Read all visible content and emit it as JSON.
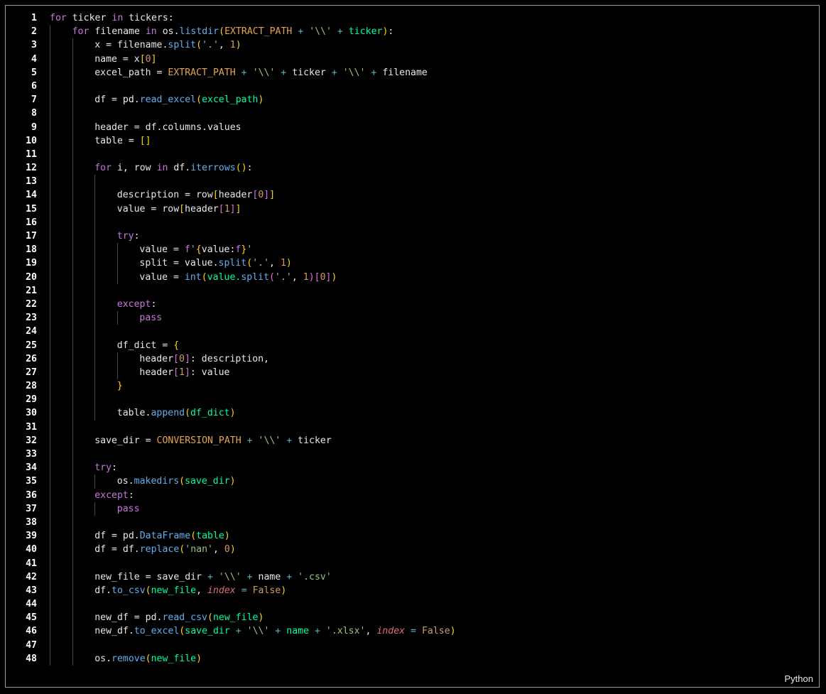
{
  "editor": {
    "language": "Python",
    "lines": [
      {
        "n": "1",
        "indent": 0,
        "tokens": [
          [
            "kw",
            "for"
          ],
          [
            "",
            "ticker"
          ],
          [
            "kw",
            "in"
          ],
          [
            "",
            "tickers:"
          ]
        ]
      },
      {
        "n": "2",
        "indent": 1,
        "tokens": [
          [
            "kw",
            "for"
          ],
          [
            "",
            "filename"
          ],
          [
            "kw",
            "in"
          ],
          [
            "",
            "os."
          ],
          [
            "fn",
            "listdir"
          ],
          [
            "b1",
            "("
          ],
          [
            "const",
            "EXTRACT_PATH"
          ],
          [
            "op",
            "+"
          ],
          [
            "str",
            "'\\\\'"
          ],
          [
            "op",
            "+"
          ],
          [
            "arg",
            "ticker"
          ],
          [
            "b1",
            ")"
          ],
          [
            "",
            ":"
          ]
        ]
      },
      {
        "n": "3",
        "indent": 2,
        "tokens": [
          [
            "",
            "x = filename."
          ],
          [
            "fn",
            "split"
          ],
          [
            "b1",
            "("
          ],
          [
            "str",
            "'.'"
          ],
          [
            "",
            ","
          ],
          [
            "num",
            "1"
          ],
          [
            "b1",
            ")"
          ]
        ]
      },
      {
        "n": "4",
        "indent": 2,
        "tokens": [
          [
            "",
            "name = x"
          ],
          [
            "b1",
            "["
          ],
          [
            "num",
            "0"
          ],
          [
            "b1",
            "]"
          ]
        ]
      },
      {
        "n": "5",
        "indent": 2,
        "tokens": [
          [
            "",
            "excel_path ="
          ],
          [
            "const",
            "EXTRACT_PATH"
          ],
          [
            "op",
            "+"
          ],
          [
            "str",
            "'\\\\'"
          ],
          [
            "op",
            "+"
          ],
          [
            "",
            "ticker"
          ],
          [
            "op",
            "+"
          ],
          [
            "str",
            "'\\\\'"
          ],
          [
            "op",
            "+"
          ],
          [
            "",
            "filename"
          ]
        ]
      },
      {
        "n": "6",
        "indent": 2,
        "tokens": []
      },
      {
        "n": "7",
        "indent": 2,
        "tokens": [
          [
            "",
            "df = pd."
          ],
          [
            "fn",
            "read_excel"
          ],
          [
            "b1",
            "("
          ],
          [
            "arg",
            "excel_path"
          ],
          [
            "b1",
            ")"
          ]
        ]
      },
      {
        "n": "8",
        "indent": 2,
        "tokens": []
      },
      {
        "n": "9",
        "indent": 2,
        "tokens": [
          [
            "",
            "header = df.columns.values"
          ]
        ]
      },
      {
        "n": "10",
        "indent": 2,
        "tokens": [
          [
            "",
            "table = "
          ],
          [
            "b1",
            "[]"
          ]
        ]
      },
      {
        "n": "11",
        "indent": 2,
        "tokens": []
      },
      {
        "n": "12",
        "indent": 2,
        "tokens": [
          [
            "kw",
            "for"
          ],
          [
            "",
            "i, row"
          ],
          [
            "kw",
            "in"
          ],
          [
            "",
            "df."
          ],
          [
            "fn",
            "iterrows"
          ],
          [
            "b1",
            "()"
          ],
          [
            "",
            ":"
          ]
        ]
      },
      {
        "n": "13",
        "indent": 3,
        "tokens": []
      },
      {
        "n": "14",
        "indent": 3,
        "tokens": [
          [
            "",
            "description = row"
          ],
          [
            "b1",
            "["
          ],
          [
            "",
            "header"
          ],
          [
            "b2",
            "["
          ],
          [
            "num",
            "0"
          ],
          [
            "b2",
            "]"
          ],
          [
            "b1",
            "]"
          ]
        ]
      },
      {
        "n": "15",
        "indent": 3,
        "tokens": [
          [
            "",
            "value = row"
          ],
          [
            "b1",
            "["
          ],
          [
            "",
            "header"
          ],
          [
            "b2",
            "["
          ],
          [
            "num",
            "1"
          ],
          [
            "b2",
            "]"
          ],
          [
            "b1",
            "]"
          ]
        ]
      },
      {
        "n": "16",
        "indent": 3,
        "tokens": []
      },
      {
        "n": "17",
        "indent": 3,
        "tokens": [
          [
            "kw",
            "try"
          ],
          [
            "",
            ":"
          ]
        ]
      },
      {
        "n": "18",
        "indent": 4,
        "tokens": [
          [
            "",
            "value ="
          ],
          [
            "kw",
            "f"
          ],
          [
            "str",
            "'"
          ],
          [
            "b1",
            "{"
          ],
          [
            "",
            "value:"
          ],
          [
            "kw",
            "f"
          ],
          [
            "b1",
            "}"
          ],
          [
            "str",
            "'"
          ]
        ]
      },
      {
        "n": "19",
        "indent": 4,
        "tokens": [
          [
            "",
            "split = value."
          ],
          [
            "fn",
            "split"
          ],
          [
            "b1",
            "("
          ],
          [
            "str",
            "'.'"
          ],
          [
            "",
            ","
          ],
          [
            "num",
            "1"
          ],
          [
            "b1",
            ")"
          ]
        ]
      },
      {
        "n": "20",
        "indent": 4,
        "tokens": [
          [
            "",
            "value ="
          ],
          [
            "fn",
            "int"
          ],
          [
            "b1",
            "("
          ],
          [
            "arg",
            "value."
          ],
          [
            "fn",
            "split"
          ],
          [
            "b2",
            "("
          ],
          [
            "str",
            "'.'"
          ],
          [
            "",
            ","
          ],
          [
            "num",
            "1"
          ],
          [
            "b2",
            ")"
          ],
          [
            "b2",
            "["
          ],
          [
            "num",
            "0"
          ],
          [
            "b2",
            "]"
          ],
          [
            "b1",
            ")"
          ]
        ]
      },
      {
        "n": "21",
        "indent": 3,
        "tokens": []
      },
      {
        "n": "22",
        "indent": 3,
        "tokens": [
          [
            "kw",
            "except"
          ],
          [
            "",
            ":"
          ]
        ]
      },
      {
        "n": "23",
        "indent": 4,
        "tokens": [
          [
            "kw",
            "pass"
          ]
        ]
      },
      {
        "n": "24",
        "indent": 3,
        "tokens": []
      },
      {
        "n": "25",
        "indent": 3,
        "tokens": [
          [
            "",
            "df_dict ="
          ],
          [
            "b1",
            "{"
          ]
        ]
      },
      {
        "n": "26",
        "indent": 4,
        "tokens": [
          [
            "",
            "header"
          ],
          [
            "b2",
            "["
          ],
          [
            "num",
            "0"
          ],
          [
            "b2",
            "]"
          ],
          [
            "",
            ": description,"
          ]
        ]
      },
      {
        "n": "27",
        "indent": 4,
        "tokens": [
          [
            "",
            "header"
          ],
          [
            "b2",
            "["
          ],
          [
            "num",
            "1"
          ],
          [
            "b2",
            "]"
          ],
          [
            "",
            ": value"
          ]
        ]
      },
      {
        "n": "28",
        "indent": 3,
        "tokens": [
          [
            "b1",
            "}"
          ]
        ]
      },
      {
        "n": "29",
        "indent": 3,
        "tokens": []
      },
      {
        "n": "30",
        "indent": 3,
        "tokens": [
          [
            "",
            "table."
          ],
          [
            "fn",
            "append"
          ],
          [
            "b1",
            "("
          ],
          [
            "arg",
            "df_dict"
          ],
          [
            "b1",
            ")"
          ]
        ]
      },
      {
        "n": "31",
        "indent": 2,
        "tokens": []
      },
      {
        "n": "32",
        "indent": 2,
        "tokens": [
          [
            "",
            "save_dir ="
          ],
          [
            "const",
            "CONVERSION_PATH"
          ],
          [
            "op",
            "+"
          ],
          [
            "str",
            "'\\\\'"
          ],
          [
            "op",
            "+"
          ],
          [
            "",
            "ticker"
          ]
        ]
      },
      {
        "n": "33",
        "indent": 2,
        "tokens": []
      },
      {
        "n": "34",
        "indent": 2,
        "tokens": [
          [
            "kw",
            "try"
          ],
          [
            "",
            ":"
          ]
        ]
      },
      {
        "n": "35",
        "indent": 3,
        "tokens": [
          [
            "",
            "os."
          ],
          [
            "fn",
            "makedirs"
          ],
          [
            "b1",
            "("
          ],
          [
            "arg",
            "save_dir"
          ],
          [
            "b1",
            ")"
          ]
        ]
      },
      {
        "n": "36",
        "indent": 2,
        "tokens": [
          [
            "kw",
            "except"
          ],
          [
            "",
            ":"
          ]
        ]
      },
      {
        "n": "37",
        "indent": 3,
        "tokens": [
          [
            "kw",
            "pass"
          ]
        ]
      },
      {
        "n": "38",
        "indent": 2,
        "tokens": []
      },
      {
        "n": "39",
        "indent": 2,
        "tokens": [
          [
            "",
            "df = pd."
          ],
          [
            "fn",
            "DataFrame"
          ],
          [
            "b1",
            "("
          ],
          [
            "arg",
            "table"
          ],
          [
            "b1",
            ")"
          ]
        ]
      },
      {
        "n": "40",
        "indent": 2,
        "tokens": [
          [
            "",
            "df = df."
          ],
          [
            "fn",
            "replace"
          ],
          [
            "b1",
            "("
          ],
          [
            "str",
            "'nan'"
          ],
          [
            "",
            ","
          ],
          [
            "num",
            "0"
          ],
          [
            "b1",
            ")"
          ]
        ]
      },
      {
        "n": "41",
        "indent": 2,
        "tokens": []
      },
      {
        "n": "42",
        "indent": 2,
        "tokens": [
          [
            "",
            "new_file = save_dir"
          ],
          [
            "op",
            "+"
          ],
          [
            "str",
            "'\\\\'"
          ],
          [
            "op",
            "+"
          ],
          [
            "",
            "name"
          ],
          [
            "op",
            "+"
          ],
          [
            "str",
            "'.csv'"
          ]
        ]
      },
      {
        "n": "43",
        "indent": 2,
        "tokens": [
          [
            "",
            "df."
          ],
          [
            "fn",
            "to_csv"
          ],
          [
            "b1",
            "("
          ],
          [
            "arg",
            "new_file"
          ],
          [
            "",
            ","
          ],
          [
            "param",
            "index"
          ],
          [
            "op",
            "="
          ],
          [
            "num",
            "False"
          ],
          [
            "b1",
            ")"
          ]
        ]
      },
      {
        "n": "44",
        "indent": 2,
        "tokens": []
      },
      {
        "n": "45",
        "indent": 2,
        "tokens": [
          [
            "",
            "new_df = pd."
          ],
          [
            "fn",
            "read_csv"
          ],
          [
            "b1",
            "("
          ],
          [
            "arg",
            "new_file"
          ],
          [
            "b1",
            ")"
          ]
        ]
      },
      {
        "n": "46",
        "indent": 2,
        "tokens": [
          [
            "",
            "new_df."
          ],
          [
            "fn",
            "to_excel"
          ],
          [
            "b1",
            "("
          ],
          [
            "arg",
            "save_dir"
          ],
          [
            "op",
            "+"
          ],
          [
            "str",
            "'\\\\'"
          ],
          [
            "op",
            "+"
          ],
          [
            "arg",
            "name"
          ],
          [
            "op",
            "+"
          ],
          [
            "str",
            "'.xlsx'"
          ],
          [
            "",
            ","
          ],
          [
            "param",
            "index"
          ],
          [
            "op",
            "="
          ],
          [
            "num",
            "False"
          ],
          [
            "b1",
            ")"
          ]
        ]
      },
      {
        "n": "47",
        "indent": 2,
        "tokens": []
      },
      {
        "n": "48",
        "indent": 2,
        "tokens": [
          [
            "",
            "os."
          ],
          [
            "fn",
            "remove"
          ],
          [
            "b1",
            "("
          ],
          [
            "arg",
            "new_file"
          ],
          [
            "b1",
            ")"
          ]
        ]
      }
    ]
  }
}
